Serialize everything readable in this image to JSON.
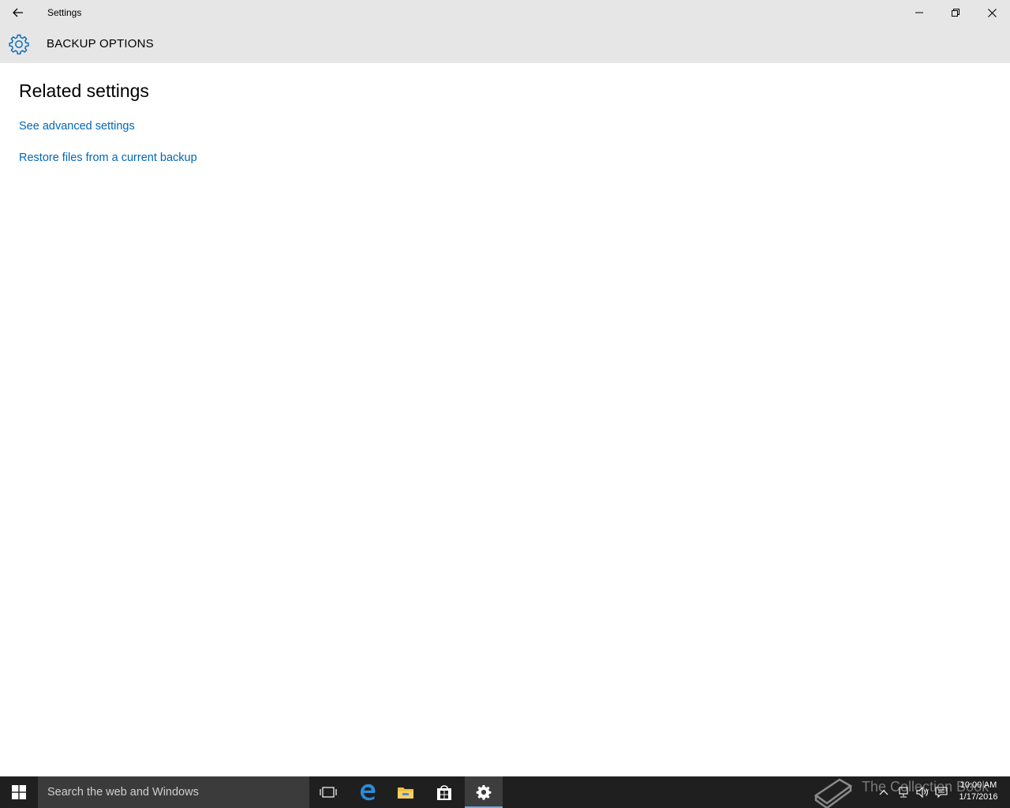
{
  "window": {
    "title": "Settings",
    "back_icon": "back-arrow-icon",
    "minimize_icon": "minimize-icon",
    "restore_icon": "restore-icon",
    "close_icon": "close-icon"
  },
  "header": {
    "icon": "gear-icon",
    "title": "BACKUP OPTIONS",
    "accent_color": "#0067b8"
  },
  "content": {
    "section_heading": "Related settings",
    "links": [
      "See advanced settings",
      "Restore files from a current backup"
    ]
  },
  "taskbar": {
    "start_icon": "windows-logo-icon",
    "search_placeholder": "Search the web and Windows",
    "apps": [
      {
        "name": "task-view-icon",
        "active": false
      },
      {
        "name": "edge-icon",
        "active": false
      },
      {
        "name": "file-explorer-icon",
        "active": false
      },
      {
        "name": "store-icon",
        "active": false
      },
      {
        "name": "settings-icon",
        "active": true
      }
    ],
    "watermark": "The Collection Book",
    "tray_icons": [
      "chevron-up-icon",
      "network-icon",
      "volume-icon",
      "action-center-icon"
    ],
    "clock_time": "10:00 AM",
    "clock_date": "1/17/2016"
  }
}
